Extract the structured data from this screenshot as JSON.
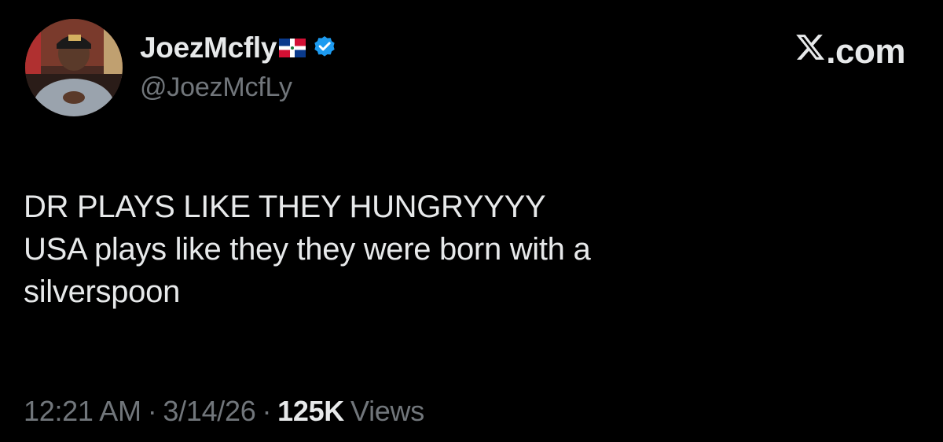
{
  "author": {
    "display_name": "JoezMcfly",
    "handle": "@JoezMcfLy",
    "flag_icon": "dominican-republic-flag-icon",
    "verified_icon": "verified-badge-icon",
    "verified_color": "#1d9bf0"
  },
  "brand": {
    "logo_icon": "x-logo-icon",
    "label": ".com"
  },
  "tweet": {
    "lines": [
      "DR PLAYS LIKE THEY HUNGRYYYY",
      "USA plays like they they were born with a",
      "silverspoon"
    ]
  },
  "meta": {
    "time": "12:21 AM",
    "separator": "·",
    "date": "3/14/26",
    "views_count": "125K",
    "views_label": "Views"
  },
  "colors": {
    "background": "#000000",
    "text_primary": "#e7e9ea",
    "text_secondary": "#71767b"
  }
}
